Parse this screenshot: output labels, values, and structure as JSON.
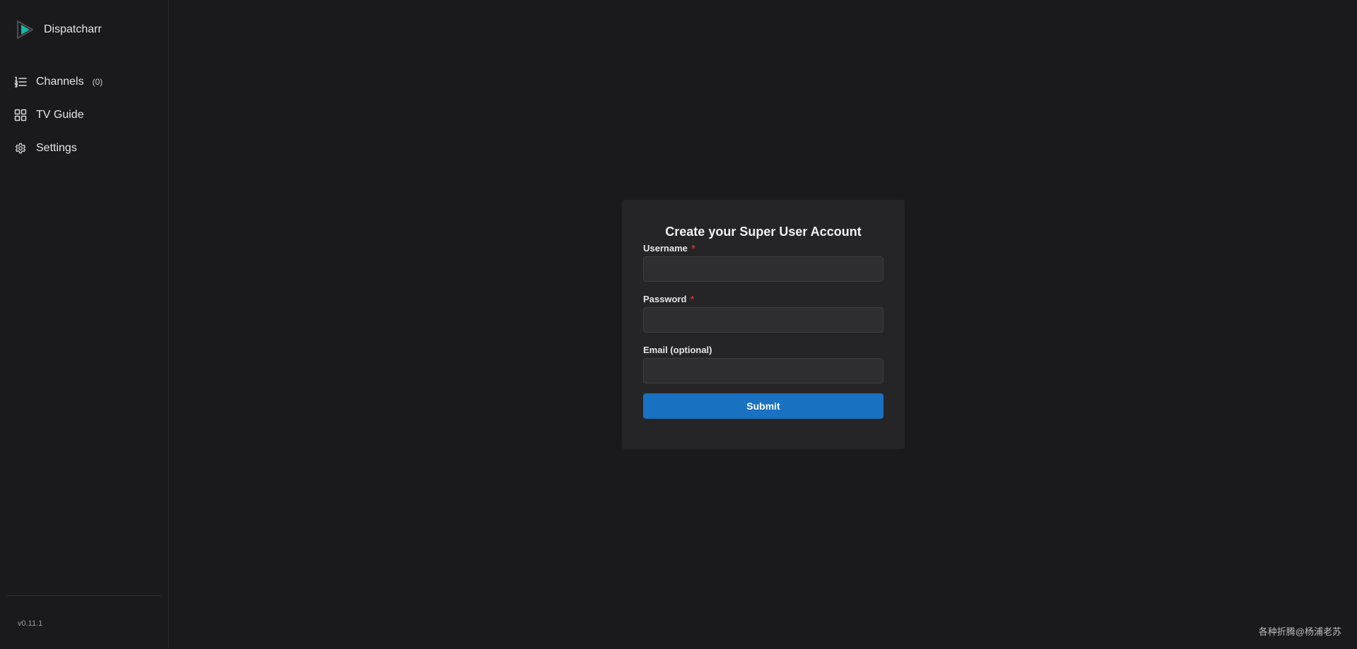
{
  "app": {
    "name": "Dispatcharr",
    "version": "v0.11.1",
    "accent": "#1971c2",
    "logo_color": "#14b8a6"
  },
  "sidebar": {
    "items": [
      {
        "label": "Channels",
        "count": "(0)",
        "icon": "list-numbers-icon"
      },
      {
        "label": "TV Guide",
        "icon": "layout-grid-icon"
      },
      {
        "label": "Settings",
        "icon": "gear-icon"
      }
    ]
  },
  "form": {
    "title": "Create your Super User Account",
    "required_marker": "*",
    "fields": [
      {
        "label": "Username",
        "required": true,
        "value": ""
      },
      {
        "label": "Password",
        "required": true,
        "value": ""
      },
      {
        "label": "Email (optional)",
        "required": false,
        "value": ""
      }
    ],
    "submit_label": "Submit"
  },
  "watermark": "各种折腾@杨浦老苏"
}
